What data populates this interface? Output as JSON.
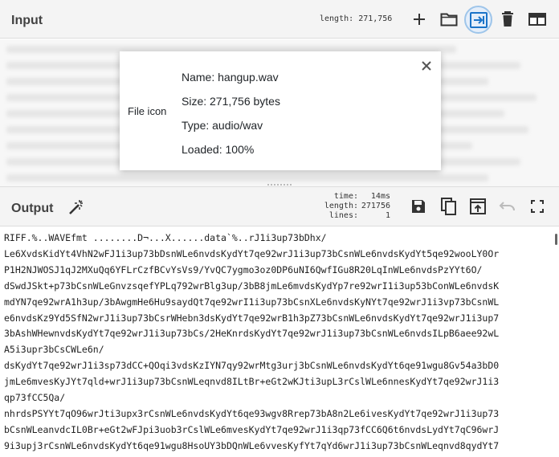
{
  "input": {
    "title": "Input",
    "length_label": "length:",
    "length_value": "271,756"
  },
  "file": {
    "icon_label": "File icon",
    "name": "Name: hangup.wav",
    "size": "Size: 271,756 bytes",
    "type": "Type: audio/wav",
    "loaded": "Loaded: 100%"
  },
  "output": {
    "title": "Output",
    "stats": {
      "time_label": "time:",
      "time_value": "14ms",
      "length_label": "length:",
      "length_value": "271756",
      "lines_label": "lines:",
      "lines_value": "1"
    },
    "text": "RIFF.%..WAVEfmt ........D¬...X......data`%..rJ1i3up73bDhx/\nLe6XvdsKidYt4VhN2wFJ1i3up73bDsnWLe6nvdsKydYt7qe92wrJ1i3up73bCsnWLe6nvdsKydYt5qe92wooLY0Or\nP1H2NJWOSJ1qJ2MXuQq6YFLrCzfBCvYsVs9/YvQC7ygmo3oz0DP6uNI6QwfIGu8R20LqInWLe6nvdsPzYYt6O/\ndSwdJSkt+p73bCsnWLeGnvzsqefYPLq792wrBlg3up/3bB8jmLe6mvdsKydYp7re92wrI1i3up53bConWLe6nvdsK\nmdYN7qe92wrA1h3up/3bAwgmHe6Hu9saydQt7qe92wrI1i3up73bCsnXLe6nvdsKyNYt7qe92wrJ1i3vp73bCsnWL\ne6nvdsKz9Yd5SfN2wrJ1i3up73bCsrWHebn3dsKydYt7qe92wrB1h3pZ73bCsnWLe6nvdsKydYt7qe92wrJ1i3up7\n3bAshWHewnvdsKydYt7qe92wrJ1i3up73bCs/2HeKnrdsKydYt7qe92wrJ1i3up73bCsnWLe6nvdsILpB6aee92wL\nA5i3upr3bCsCWLe6n/\ndsKydYt7qe92wrJ1i3sp73dCC+QOqi3vdsKzIYN7qy92wrMtg3urj3bCsnWLe6nvdsKydYt6qe91wgu8Gv54a3bD0\njmLe6mvesKyJYt7qld+wrJ1i3up73bCsnWLeqnvd8ILtBr+eGt2wKJti3upL3rCslWLe6nnesKydYt7qe92wrJ1i3\nqp73fCC5Qa/\nnhrdsPSYYt7qO96wrJti3upx3rCsnWLe6nvdsKydYt6qe93wgv8Rrep73bA8n2Le6ivesKydYt7qe92wrJ1i3up73\nbCsnWLeanvdcIL0Br+eGt2wFJpi3uob3rCslWLe6mvesKydYt7qe92wrJ1i3qp73fCC6Q6t6nvdsLydYt7qC96wrJ\n9i3upj3rCsnWLe6nvdsKydYt6qe91wgu8HsoUY3bDQnWLe6vvesKyfYt7qYd6wrJ1i3up73bCsnWLeqnvd8qydYt7"
  }
}
